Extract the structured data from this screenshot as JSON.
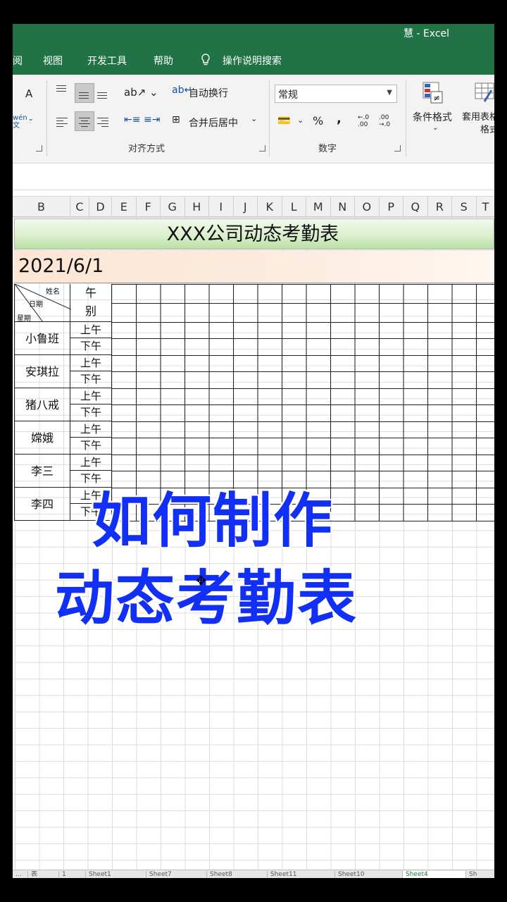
{
  "app": {
    "title": "慧 - Excel"
  },
  "menu": [
    "阅",
    "视图",
    "开发工具",
    "帮助",
    "操作说明搜索"
  ],
  "ribbon": {
    "font_group": {
      "increase_font": "A",
      "phonetic": "wén 文"
    },
    "alignment_group": {
      "label": "对齐方式",
      "wrap_text": "自动换行",
      "merge_center": "合并后居中"
    },
    "number_group": {
      "label": "数字",
      "format_value": "常规",
      "percent": "%",
      "comma": ",",
      "inc_decimal": "←.0 .00",
      "dec_decimal": ".00 →.0"
    },
    "styles_group": {
      "conditional_format": "条件格式",
      "table_format": "套用表格格式"
    }
  },
  "columns": [
    "B",
    "C",
    "D",
    "E",
    "F",
    "G",
    "H",
    "I",
    "J",
    "K",
    "L",
    "M",
    "N",
    "O",
    "P",
    "Q",
    "R",
    "S",
    "T"
  ],
  "sheet": {
    "title": "XXX公司动态考勤表",
    "date": "2021/6/1",
    "header": {
      "name": "姓名",
      "date": "日期",
      "weekday": "星期",
      "period_top": "午",
      "period_bottom": "别"
    },
    "employees": [
      {
        "name": "小鲁班",
        "am": "上午",
        "pm": "下午"
      },
      {
        "name": "安琪拉",
        "am": "上午",
        "pm": "下午"
      },
      {
        "name": "猪八戒",
        "am": "上午",
        "pm": "下午"
      },
      {
        "name": "嫦娥",
        "am": "上午",
        "pm": "下午"
      },
      {
        "name": "李三",
        "am": "上午",
        "pm": "下午"
      },
      {
        "name": "李四",
        "am": "上午",
        "pm": "下午"
      }
    ]
  },
  "overlay": {
    "line1": "如何制作",
    "line2": "动态考勤表"
  },
  "sheet_tabs": [
    "...",
    "表",
    "1",
    "Sheet1",
    "Sheet7",
    "Sheet8",
    "Sheet11",
    "Sheet10",
    "Sheet4",
    "Sh"
  ],
  "colors": {
    "excel_green": "#217346",
    "overlay_blue": "#1230f5"
  }
}
